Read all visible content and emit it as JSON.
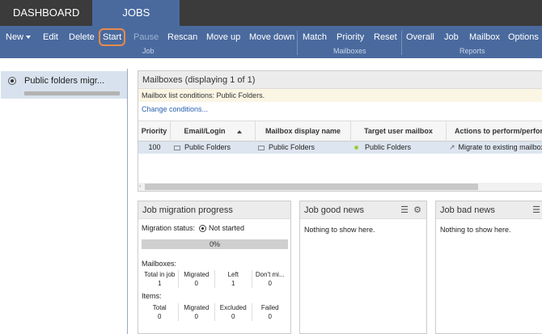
{
  "topnav": {
    "tabs": [
      {
        "label": "DASHBOARD"
      },
      {
        "label": "JOBS"
      }
    ]
  },
  "toolbar": {
    "job": {
      "group": "Job",
      "new": "New",
      "edit": "Edit",
      "delete": "Delete",
      "start": "Start",
      "pause": "Pause",
      "rescan": "Rescan",
      "move_up": "Move up",
      "move_down": "Move down"
    },
    "mailboxes": {
      "group": "Mailboxes",
      "match": "Match",
      "priority": "Priority",
      "reset": "Reset"
    },
    "reports": {
      "group": "Reports",
      "overall": "Overall",
      "job": "Job",
      "mailbox": "Mailbox",
      "options": "Options"
    }
  },
  "left": {
    "job_name": "Public folders migr..."
  },
  "mailboxes": {
    "title": "Mailboxes (displaying 1 of 1)",
    "conditions": "Mailbox list conditions: Public Folders.",
    "change_link": "Change conditions...",
    "columns": [
      "Priority",
      "Email/Login",
      "Mailbox display name",
      "Target user mailbox",
      "Actions to perform/perform"
    ],
    "rows": [
      {
        "priority": "100",
        "email": "Public Folders",
        "display_name": "Public Folders",
        "target": "Public Folders",
        "action": "Migrate to existing mailbox"
      }
    ]
  },
  "progress": {
    "title": "Job migration progress",
    "status_label": "Migration status:",
    "status_value": "Not started",
    "percent_label": "0%",
    "percent": 0,
    "mailboxes_label": "Mailboxes:",
    "mailbox_stats": [
      {
        "label": "Total in job",
        "value": "1"
      },
      {
        "label": "Migrated",
        "value": "0"
      },
      {
        "label": "Left",
        "value": "1"
      },
      {
        "label": "Don't mi...",
        "value": "0"
      }
    ],
    "items_label": "Items:",
    "item_stats": [
      {
        "label": "Total",
        "value": "0"
      },
      {
        "label": "Migrated",
        "value": "0"
      },
      {
        "label": "Excluded",
        "value": "0"
      },
      {
        "label": "Failed",
        "value": "0"
      }
    ]
  },
  "good_news": {
    "title": "Job good news",
    "empty": "Nothing to show here."
  },
  "bad_news": {
    "title": "Job bad news",
    "empty": "Nothing to show here."
  }
}
